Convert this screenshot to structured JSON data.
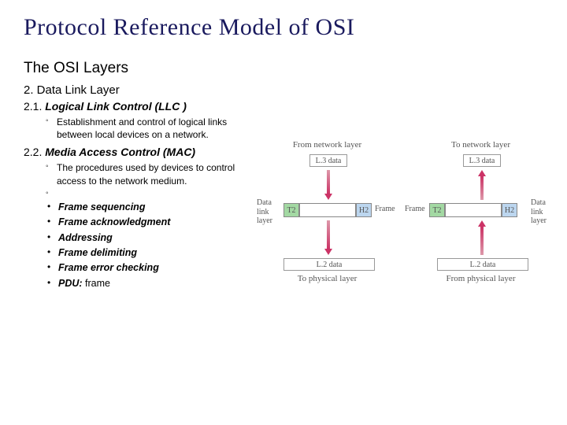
{
  "title": "Protocol Reference Model of OSI",
  "subtitle": "The OSI Layers",
  "section_h": "2. Data Link Layer",
  "subsection1": {
    "num": "2.1.",
    "name": "Logical Link Control (LLC )"
  },
  "subsection1_text": "Establishment and control of logical links between local devices on a network.",
  "subsection2": {
    "num": "2.2.",
    "name": "Media Access Control (MAC)"
  },
  "subsection2_text": "The procedures used by devices to control access to the network medium.",
  "bullets": [
    {
      "label": "Frame sequencing"
    },
    {
      "label": "Frame acknowledgment"
    },
    {
      "label": "Addressing"
    },
    {
      "label": "Frame delimiting"
    },
    {
      "label": "Frame error checking"
    },
    {
      "label_prefix": "PDU:",
      "label_rest": " frame"
    }
  ],
  "diagram": {
    "left": {
      "top": "From network layer",
      "l3": "L.3 data",
      "dll": "Data link layer",
      "t2": "T2",
      "h2": "H2",
      "frame": "Frame",
      "l2": "L.2 data",
      "bottom": "To physical layer"
    },
    "right": {
      "top": "To network layer",
      "l3": "L.3 data",
      "dll": "Data link layer",
      "t2": "T2",
      "h2": "H2",
      "frame": "Frame",
      "l2": "L.2 data",
      "bottom": "From physical layer"
    }
  }
}
